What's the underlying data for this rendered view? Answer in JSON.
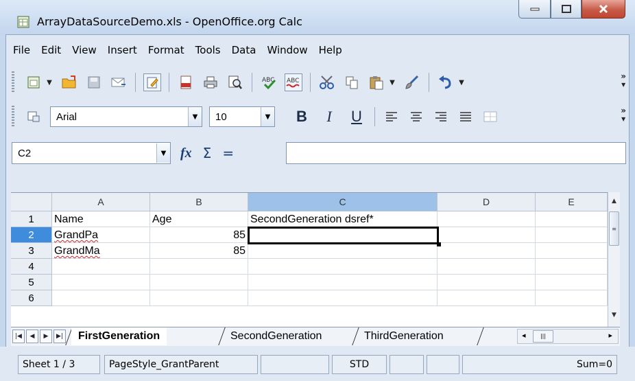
{
  "window": {
    "title": "ArrayDataSourceDemo.xls - OpenOffice.org Calc"
  },
  "menu": [
    "File",
    "Edit",
    "View",
    "Insert",
    "Format",
    "Tools",
    "Data",
    "Window",
    "Help"
  ],
  "format_toolbar": {
    "font_name": "Arial",
    "font_size": "10",
    "bold": "B",
    "italic": "I",
    "underline": "U"
  },
  "formula_bar": {
    "cell_reference": "C2",
    "content": ""
  },
  "grid": {
    "columns": [
      "A",
      "B",
      "C",
      "D",
      "E"
    ],
    "selected_column": "C",
    "rows": [
      {
        "num": "1",
        "cells": [
          "Name",
          "Age",
          "SecondGeneration dsref*",
          "",
          ""
        ]
      },
      {
        "num": "2",
        "cells": [
          "GrandPa",
          "85",
          "",
          "",
          ""
        ]
      },
      {
        "num": "3",
        "cells": [
          "GrandMa",
          "85",
          "",
          "",
          ""
        ]
      },
      {
        "num": "4",
        "cells": [
          "",
          "",
          "",
          "",
          ""
        ]
      },
      {
        "num": "5",
        "cells": [
          "",
          "",
          "",
          "",
          ""
        ]
      },
      {
        "num": "6",
        "cells": [
          "",
          "",
          "",
          "",
          ""
        ]
      }
    ],
    "selected_cell": "C2"
  },
  "sheets": {
    "tabs": [
      "FirstGeneration",
      "SecondGeneration",
      "ThirdGeneration"
    ],
    "active": "FirstGeneration"
  },
  "statusbar": {
    "sheet_position": "Sheet 1 / 3",
    "page_style": "PageStyle_GrantParent",
    "selection_mode": "STD",
    "sum": "Sum=0"
  }
}
